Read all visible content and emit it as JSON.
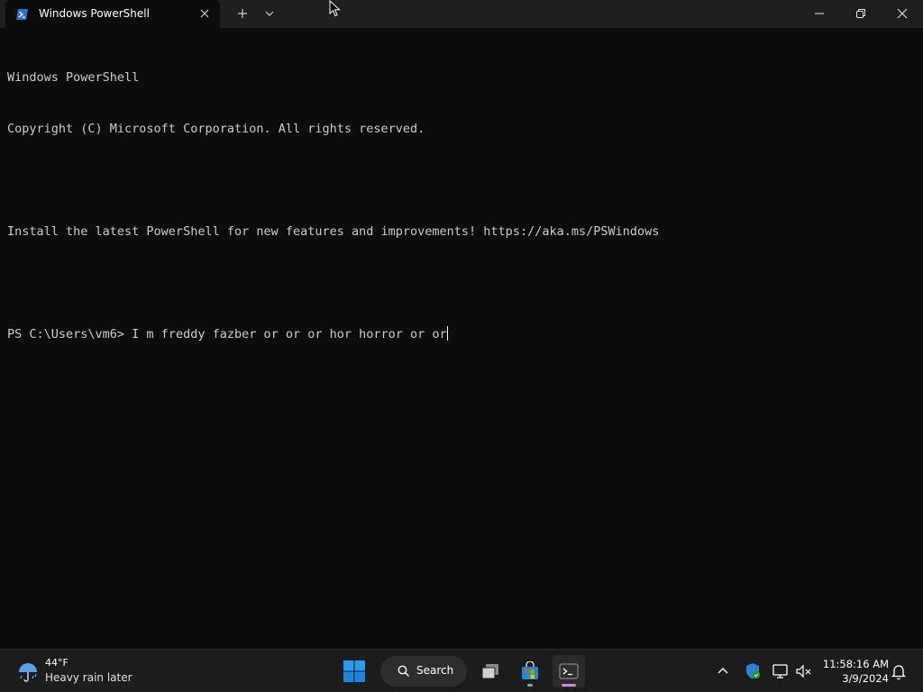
{
  "window": {
    "tab_title": "Windows PowerShell",
    "tab_icon": "powershell-icon",
    "new_tab_icon": "plus-icon",
    "dropdown_icon": "chevron-down-icon",
    "controls": [
      "minimize-icon",
      "maximize-icon",
      "close-icon"
    ]
  },
  "terminal": {
    "lines": [
      "Windows PowerShell",
      "Copyright (C) Microsoft Corporation. All rights reserved.",
      "",
      "Install the latest PowerShell for new features and improvements! https://aka.ms/PSWindows",
      ""
    ],
    "prompt": "PS C:\\Users\\vm6> ",
    "input": "I m freddy fazber or or or hor horror or or",
    "text_color": "#cccccc",
    "background": "#0c0c0c"
  },
  "taskbar": {
    "weather": {
      "temperature": "44°F",
      "description": "Heavy rain later",
      "icon": "rain-umbrella-icon"
    },
    "search_label": "Search",
    "apps": [
      {
        "name": "task-view",
        "icon": "task-view-icon"
      },
      {
        "name": "microsoft-store",
        "icon": "store-icon"
      },
      {
        "name": "terminal",
        "icon": "terminal-icon",
        "active": true
      }
    ],
    "tray": {
      "icons": [
        "chevron-up-icon",
        "defender-icon",
        "network-icon",
        "volume-muted-icon",
        "bell-icon"
      ],
      "time": "11:58:16 AM",
      "date": "3/9/2024"
    },
    "accent": "#0078d4"
  }
}
